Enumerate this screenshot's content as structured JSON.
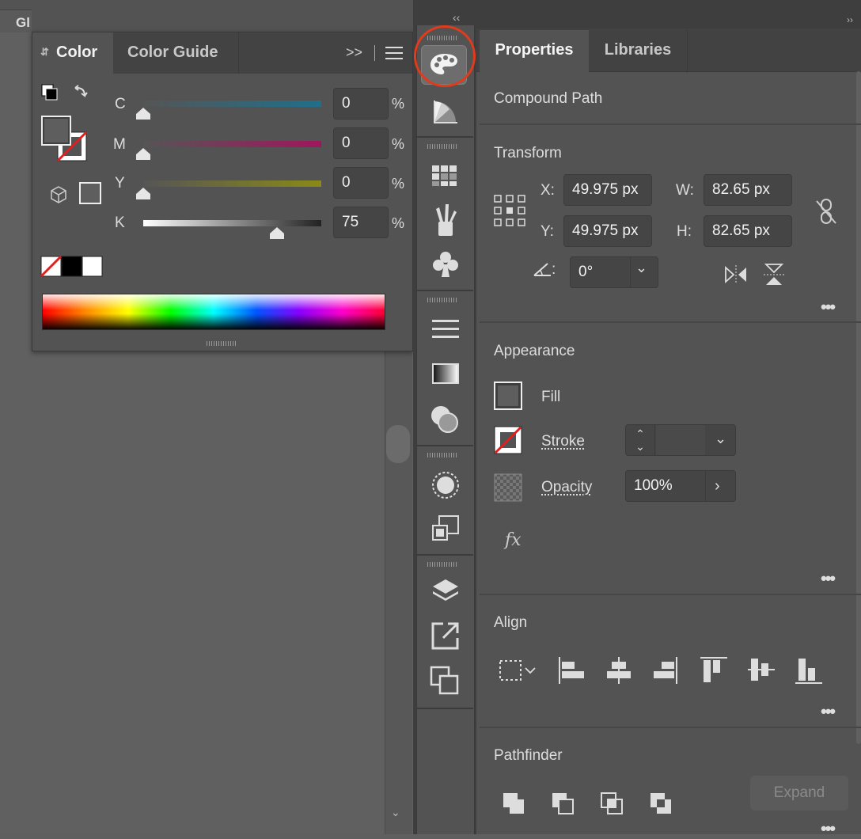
{
  "canvas": {
    "tab_label": "Gl"
  },
  "color_panel": {
    "tabs": [
      "Color",
      "Color Guide"
    ],
    "expand_label": ">>",
    "sliders": [
      {
        "label": "C",
        "value": "0",
        "unit": "%",
        "level": 0.0,
        "color": "#1f6f8b"
      },
      {
        "label": "M",
        "value": "0",
        "unit": "%",
        "level": 0.0,
        "color": "#a0165d"
      },
      {
        "label": "Y",
        "value": "0",
        "unit": "%",
        "level": 0.0,
        "color": "#8a8a17"
      },
      {
        "label": "K",
        "value": "75",
        "unit": "%",
        "level": 0.75,
        "color": "#222222"
      }
    ]
  },
  "strip": {
    "collapse_label": "‹‹",
    "icons": [
      "palette-icon",
      "color-guide-icon",
      "swatches-icon",
      "brushes-icon",
      "symbols-icon",
      "stroke-icon",
      "gradient-icon",
      "transparency-icon",
      "appearance-icon",
      "graphic-styles-icon",
      "layers-icon",
      "asset-export-icon",
      "artboards-icon"
    ]
  },
  "properties": {
    "tabs": [
      "Properties",
      "Libraries"
    ],
    "object_type": "Compound Path",
    "transform": {
      "title": "Transform",
      "x_label": "X:",
      "x_value": "49.975 px",
      "y_label": "Y:",
      "y_value": "49.975 px",
      "w_label": "W:",
      "w_value": "82.65 px",
      "h_label": "H:",
      "h_value": "82.65 px",
      "angle_value": "0°"
    },
    "appearance": {
      "title": "Appearance",
      "fill_label": "Fill",
      "stroke_label": "Stroke",
      "opacity_label": "Opacity",
      "opacity_value": "100%",
      "fx_label": "fx"
    },
    "align": {
      "title": "Align"
    },
    "pathfinder": {
      "title": "Pathfinder",
      "expand_label": "Expand"
    },
    "more_label": "•••"
  },
  "colors": {
    "accent_circle": "#e23b1c",
    "panel_bg": "#535353",
    "field_bg": "#454545"
  }
}
